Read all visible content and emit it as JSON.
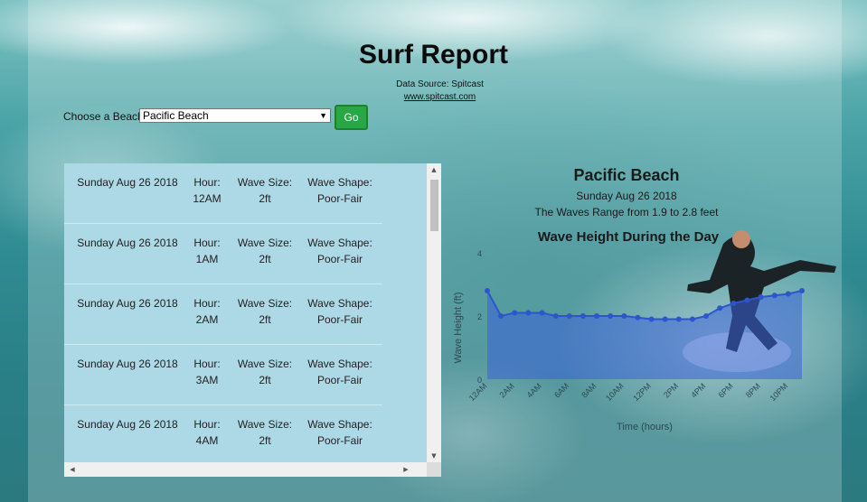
{
  "page": {
    "title": "Surf Report",
    "source": "Data Source: Spitcast",
    "source_link": "www.spitcast.com"
  },
  "form": {
    "label": "Choose a Beach",
    "selected_beach": "Pacific Beach",
    "go_label": "Go"
  },
  "forecast": {
    "rows": [
      {
        "date": "Sunday Aug 26 2018",
        "hour_label": "Hour:",
        "hour": "12AM",
        "size_label": "Wave Size:",
        "size": "2ft",
        "shape_label": "Wave Shape:",
        "shape": "Poor-Fair"
      },
      {
        "date": "Sunday Aug 26 2018",
        "hour_label": "Hour:",
        "hour": "1AM",
        "size_label": "Wave Size:",
        "size": "2ft",
        "shape_label": "Wave Shape:",
        "shape": "Poor-Fair"
      },
      {
        "date": "Sunday Aug 26 2018",
        "hour_label": "Hour:",
        "hour": "2AM",
        "size_label": "Wave Size:",
        "size": "2ft",
        "shape_label": "Wave Shape:",
        "shape": "Poor-Fair"
      },
      {
        "date": "Sunday Aug 26 2018",
        "hour_label": "Hour:",
        "hour": "3AM",
        "size_label": "Wave Size:",
        "size": "2ft",
        "shape_label": "Wave Shape:",
        "shape": "Poor-Fair"
      },
      {
        "date": "Sunday Aug 26 2018",
        "hour_label": "Hour:",
        "hour": "4AM",
        "size_label": "Wave Size:",
        "size": "2ft",
        "shape_label": "Wave Shape:",
        "shape": "Poor-Fair"
      }
    ]
  },
  "summary": {
    "beach": "Pacific Beach",
    "date": "Sunday Aug 26 2018",
    "range": "The Waves Range from 1.9 to 2.8 feet"
  },
  "chart_data": {
    "type": "area",
    "title": "Wave Height During the Day",
    "xlabel": "Time (hours)",
    "ylabel": "Wave Height (ft)",
    "yticks": [
      "0",
      "2",
      "4"
    ],
    "ylim": [
      0,
      4
    ],
    "x": [
      "12AM",
      "1AM",
      "2AM",
      "3AM",
      "4AM",
      "5AM",
      "6AM",
      "7AM",
      "8AM",
      "9AM",
      "10AM",
      "11AM",
      "12PM",
      "1PM",
      "2PM",
      "3PM",
      "4PM",
      "5PM",
      "6PM",
      "7PM",
      "8PM",
      "9PM",
      "10PM",
      "11PM"
    ],
    "xticks": [
      "12AM",
      "2AM",
      "4AM",
      "6AM",
      "8AM",
      "10AM",
      "12PM",
      "2PM",
      "4PM",
      "6PM",
      "8PM",
      "10PM"
    ],
    "series": [
      {
        "values": [
          2.8,
          2.0,
          2.1,
          2.1,
          2.1,
          2.0,
          2.0,
          2.0,
          2.0,
          2.0,
          2.0,
          1.95,
          1.9,
          1.9,
          1.9,
          1.9,
          2.0,
          2.25,
          2.4,
          2.5,
          2.6,
          2.65,
          2.7,
          2.8
        ]
      }
    ],
    "colors": {
      "fill": "#3a63d8",
      "line": "#2e55cc"
    }
  }
}
